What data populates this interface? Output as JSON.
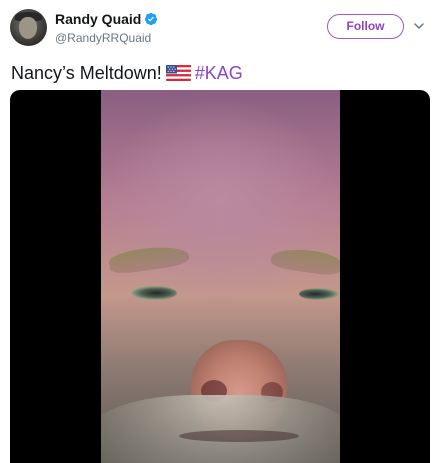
{
  "author": {
    "display_name": "Randy Quaid",
    "handle": "@RandyRRQuaid",
    "verified": true
  },
  "follow_button": {
    "label": "Follow"
  },
  "tweet": {
    "text_before_flag": "Nancy’s Meltdown!",
    "flag_icon": "us-flag-icon",
    "hashtag": "#KAG"
  },
  "media": {
    "type": "video",
    "aspect": "portrait"
  },
  "colors": {
    "accent": "#8e44c4",
    "verified_blue": "#1da1f2",
    "text": "#14171a",
    "secondary_text": "#657786"
  }
}
